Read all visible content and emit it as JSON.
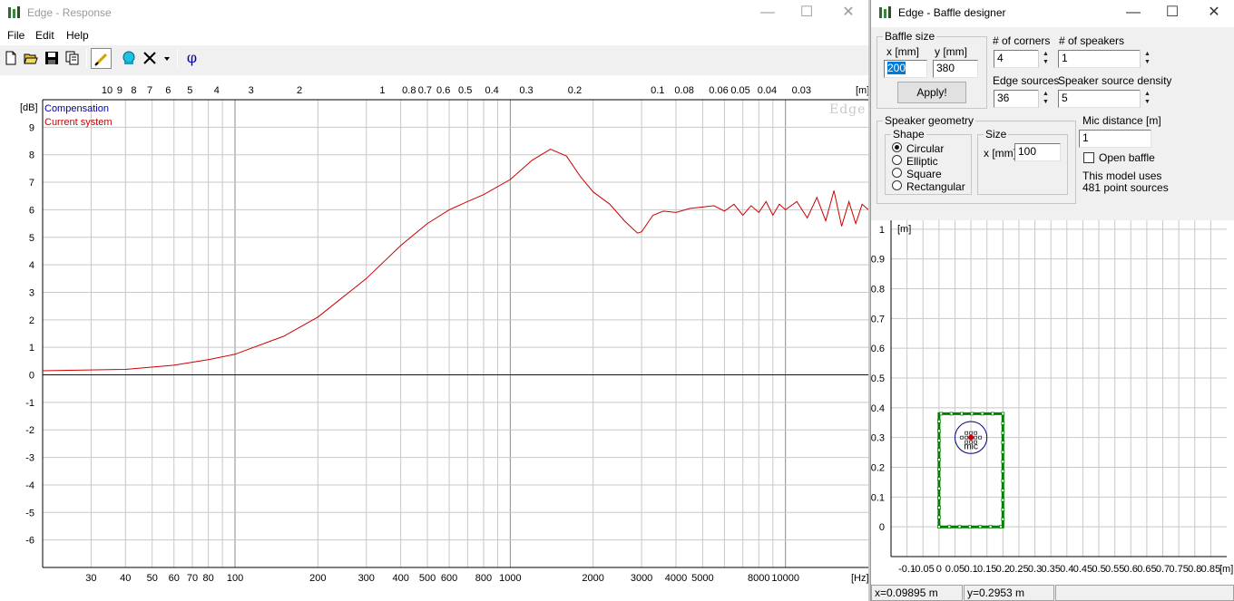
{
  "response_window": {
    "title": "Edge - Response",
    "menu": [
      "File",
      "Edit",
      "Help"
    ],
    "toolbar_icons": [
      "new-file-icon",
      "open-folder-icon",
      "save-icon",
      "copy-icon",
      "draw-icon",
      "speaker-icon",
      "delete-icon",
      "dropdown-arrow-icon",
      "phase-icon"
    ],
    "phase_symbol": "φ",
    "watermark": "Edge"
  },
  "baffle_window": {
    "title": "Edge - Baffle designer",
    "baffle_size": {
      "group_label": "Baffle size",
      "x_label": "x [mm]",
      "x_value": "200",
      "y_label": "y [mm]",
      "y_value": "380",
      "apply_label": "Apply!"
    },
    "corners": {
      "label": "# of corners",
      "value": "4"
    },
    "speakers": {
      "label": "# of speakers",
      "value": "1"
    },
    "edge_sources": {
      "label": "Edge sources",
      "value": "36"
    },
    "speaker_density": {
      "label": "Speaker source density",
      "value": "5"
    },
    "speaker_geometry": {
      "group_label": "Speaker geometry",
      "shape_label": "Shape",
      "shapes": [
        "Circular",
        "Elliptic",
        "Square",
        "Rectangular"
      ],
      "selected": "Circular",
      "size_label": "Size",
      "size_x_label": "x [mm]",
      "size_x_value": "100"
    },
    "mic_distance": {
      "label": "Mic distance [m]",
      "value": "1"
    },
    "open_baffle": {
      "label": "Open baffle",
      "checked": false
    },
    "model_info": {
      "line1": "This model uses",
      "line2": "481 point sources"
    },
    "status": {
      "x": "x=0.09895 m",
      "y": "y=0.2953 m"
    },
    "mic_label": "mic"
  },
  "chart_data": [
    {
      "type": "line",
      "title": "",
      "xlabel": "[Hz]",
      "ylabel": "[dB]",
      "x_scale": "log",
      "xlim": [
        20,
        20000
      ],
      "ylim": [
        -7,
        10
      ],
      "grid": true,
      "legend_position": "top-left",
      "x_ticks": [
        "30",
        "40",
        "50",
        "60",
        "70",
        "80",
        "100",
        "200",
        "300",
        "400",
        "500",
        "600",
        "800",
        "1000",
        "2000",
        "3000",
        "4000",
        "5000",
        "8000",
        "10000"
      ],
      "y_ticks": [
        "9",
        "8",
        "7",
        "6",
        "5",
        "4",
        "3",
        "2",
        "1",
        "0",
        "-1",
        "-2",
        "-3",
        "-4",
        "-5",
        "-6"
      ],
      "top_axis_label": "[m]",
      "top_axis_ticks": [
        "10",
        "9",
        "8",
        "7",
        "6",
        "5",
        "4",
        "3",
        "2",
        "1",
        "0.8",
        "0.7",
        "0.6",
        "0.5",
        "0.4",
        "0.3",
        "0.2",
        "0.1",
        "0.08",
        "0.06",
        "0.05",
        "0.04",
        "0.03"
      ],
      "series": [
        {
          "name": "Compensation",
          "color": "#0000a0",
          "x": [
            20,
            20000
          ],
          "y": [
            0,
            0
          ]
        },
        {
          "name": "Current system",
          "color": "#cc0000",
          "x": [
            20,
            40,
            60,
            80,
            100,
            150,
            200,
            300,
            400,
            500,
            600,
            700,
            800,
            1000,
            1200,
            1400,
            1600,
            1800,
            2000,
            2300,
            2600,
            2900,
            3000,
            3300,
            3600,
            4000,
            4500,
            5000,
            5500,
            6000,
            6500,
            7000,
            7500,
            8000,
            8500,
            9000,
            9500,
            10000,
            11000,
            12000,
            13000,
            14000,
            15000,
            16000,
            17000,
            18000,
            19000,
            20000
          ],
          "y": [
            0.15,
            0.2,
            0.35,
            0.55,
            0.75,
            1.4,
            2.1,
            3.5,
            4.7,
            5.5,
            6.0,
            6.3,
            6.55,
            7.1,
            7.8,
            8.2,
            7.95,
            7.2,
            6.65,
            6.2,
            5.6,
            5.15,
            5.2,
            5.8,
            5.95,
            5.9,
            6.05,
            6.1,
            6.15,
            5.95,
            6.2,
            5.8,
            6.15,
            5.9,
            6.3,
            5.8,
            6.2,
            6.0,
            6.3,
            5.7,
            6.45,
            5.6,
            6.7,
            5.4,
            6.3,
            5.5,
            6.2,
            6.0
          ]
        }
      ]
    },
    {
      "type": "scatter",
      "title": "",
      "xlabel": "[m]",
      "ylabel": "[m]",
      "xlim": [
        -0.15,
        0.9
      ],
      "ylim": [
        -0.1,
        1.03
      ],
      "grid": true,
      "x_ticks": [
        "-0.1",
        "-0.05",
        "0",
        "0.05",
        "0.1",
        "0.15",
        "0.2",
        "0.25",
        "0.3",
        "0.35",
        "0.4",
        "0.45",
        "0.5",
        "0.55",
        "0.6",
        "0.65",
        "0.7",
        "0.75",
        "0.8",
        "0.85"
      ],
      "y_ticks": [
        "1",
        "0.9",
        "0.8",
        "0.7",
        "0.6",
        "0.5",
        "0.4",
        "0.3",
        "0.2",
        "0.1",
        "0"
      ],
      "baffle_outline": {
        "x": [
          0,
          0.2,
          0.2,
          0,
          0
        ],
        "y": [
          0,
          0,
          0.38,
          0.38,
          0
        ],
        "color": "#008000"
      },
      "speaker": {
        "center": [
          0.1,
          0.3
        ],
        "diameter": 0.1,
        "color": "#000080"
      },
      "mic_position": [
        0.1,
        0.3
      ],
      "mic_color": "#cc0000"
    }
  ]
}
